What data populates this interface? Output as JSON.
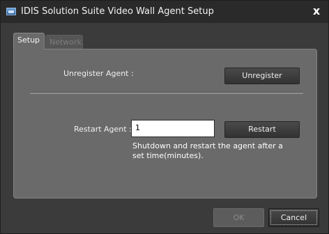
{
  "window": {
    "title": "IDIS Solution Suite Video Wall Agent Setup",
    "close_glyph": "x"
  },
  "tabs": [
    {
      "label": "Setup",
      "active": true
    },
    {
      "label": "Network",
      "active": false
    }
  ],
  "setup": {
    "unregister_label": "Unregister Agent :",
    "unregister_button": "Unregister",
    "restart_label": "Restart Agent :",
    "restart_value": "1",
    "restart_button": "Restart",
    "restart_hint": "Shutdown and restart the agent after a set time(minutes)."
  },
  "footer": {
    "ok_label": "OK",
    "ok_enabled": false,
    "cancel_label": "Cancel"
  },
  "colors": {
    "titlebar": "#2a2a2a",
    "panel": "#6a6a6a",
    "button": "#3a3a3a"
  },
  "icons": {
    "app": "video-wall-app-icon",
    "close": "close-icon"
  }
}
